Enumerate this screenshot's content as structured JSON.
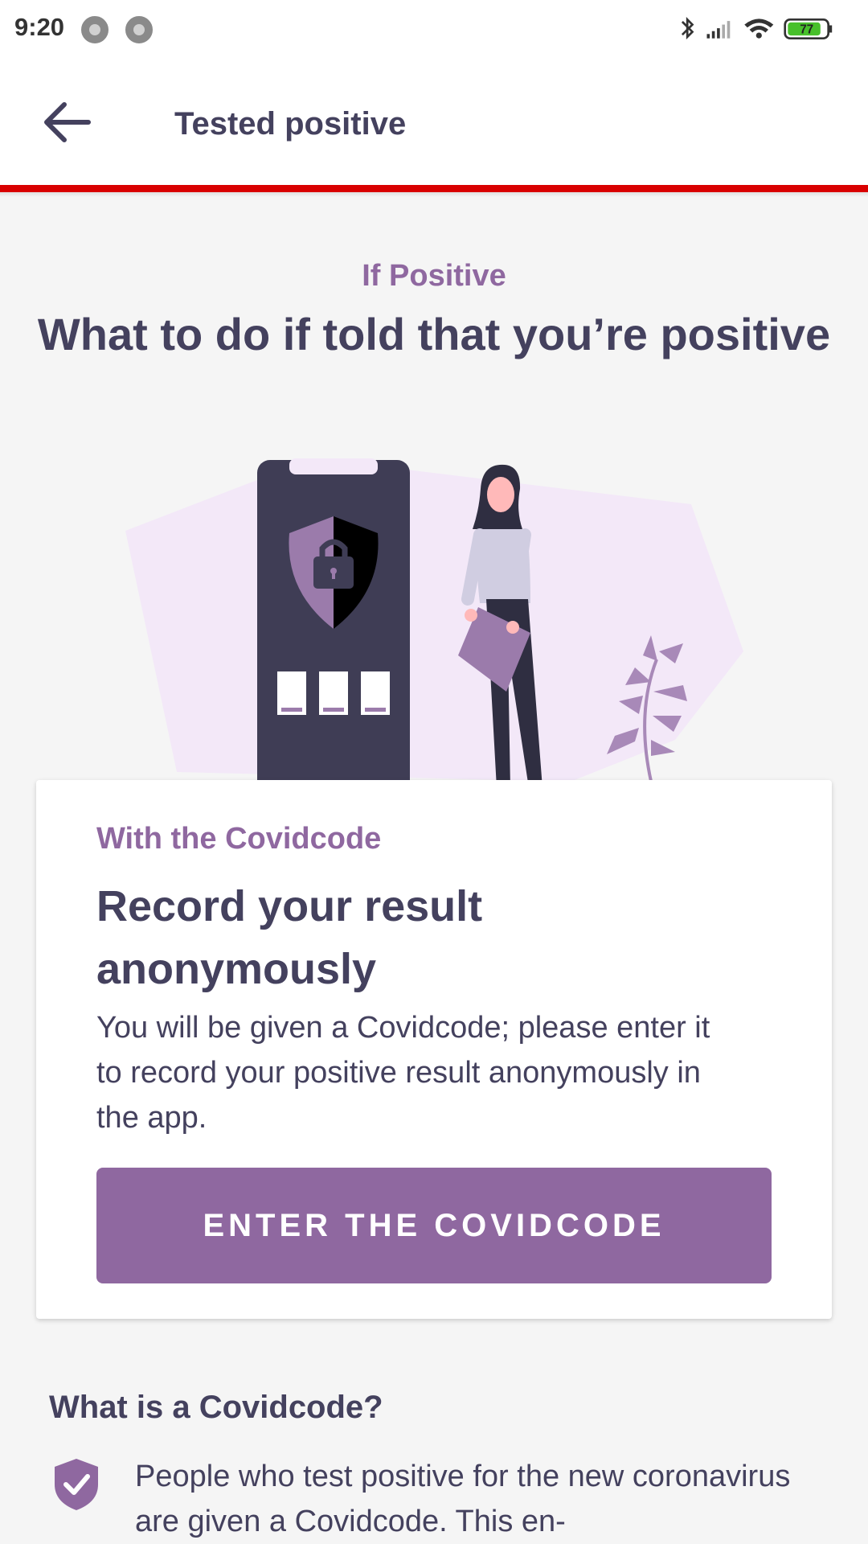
{
  "status_bar": {
    "time": "9:20",
    "battery": "77",
    "icons": [
      "notification-icon",
      "notification-icon",
      "bluetooth-icon",
      "signal-icon",
      "wifi-icon",
      "battery-icon"
    ]
  },
  "app_bar": {
    "title": "Tested positive",
    "back_icon": "back-arrow-icon",
    "accent_color": "#d90000"
  },
  "intro": {
    "eyebrow": "If Positive",
    "headline": "What to do if told that you’re positive"
  },
  "card": {
    "label": "With the Covidcode",
    "title": "Record your result anonymously",
    "body": "You will be given a Covidcode; please enter it to record your positive result anonymously in the app.",
    "button_label": "ENTER THE COVIDCODE"
  },
  "info": {
    "title": "What is a Covidcode?",
    "icon": "shield-check-icon",
    "text": "People who test positive for the new coronavirus are given a Covidcode. This en-"
  },
  "colors": {
    "primary": "#8f68a0",
    "text": "#44415e",
    "background": "#f5f5f5",
    "accent": "#d90000"
  }
}
